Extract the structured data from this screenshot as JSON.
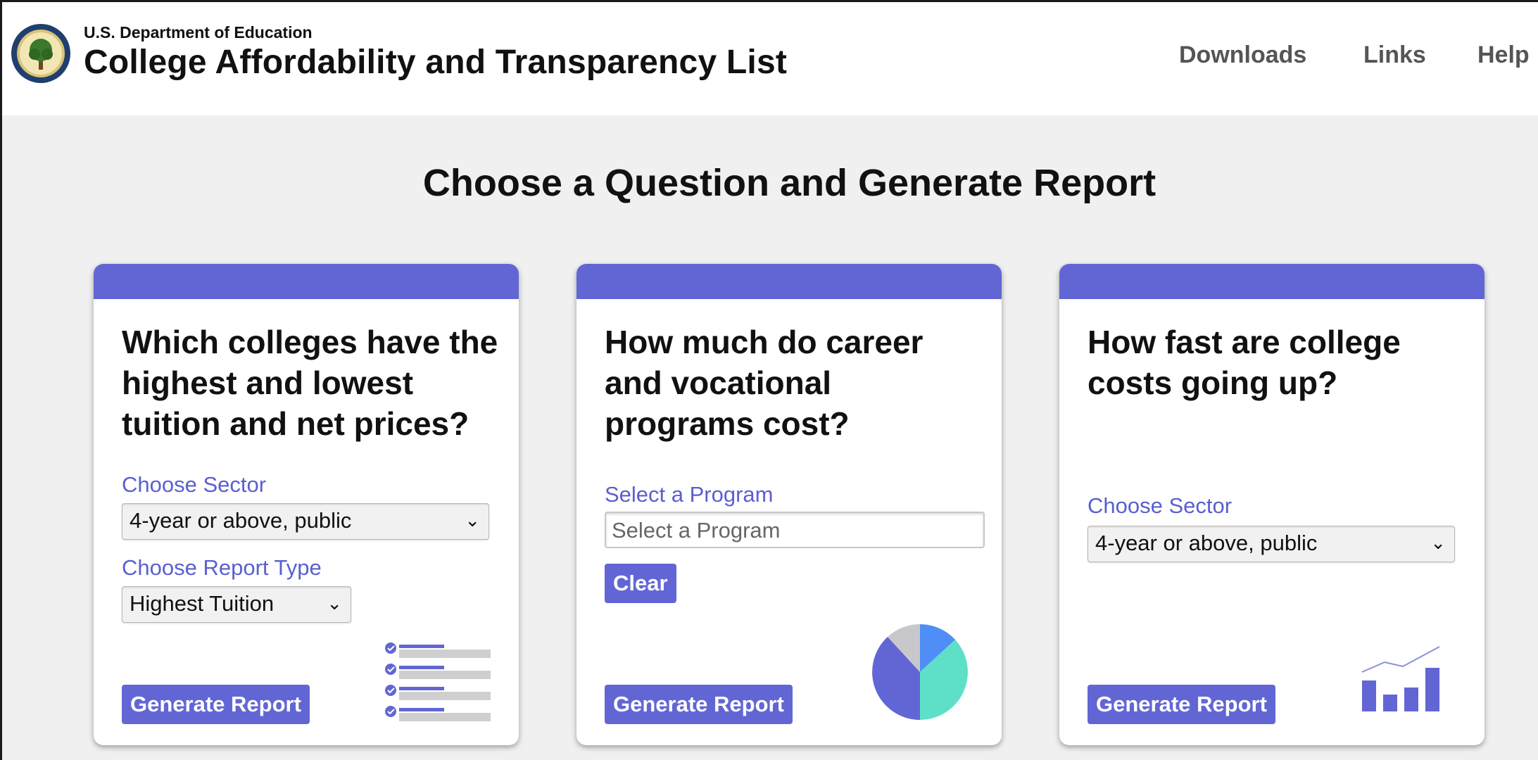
{
  "header": {
    "department": "U.S. Department of Education",
    "title": "College Affordability and Transparency List",
    "nav": [
      "Downloads",
      "Links",
      "Help"
    ]
  },
  "main": {
    "heading": "Choose a Question and Generate Report"
  },
  "cards": [
    {
      "question": "Which colleges have the highest and lowest tuition and net prices?",
      "sector_label": "Choose Sector",
      "sector_value": "4-year or above, public",
      "report_type_label": "Choose Report Type",
      "report_type_value": "Highest Tuition",
      "button": "Generate Report",
      "illustration": "checklist-icon"
    },
    {
      "question": "How much do career and vocational programs cost?",
      "program_label": "Select a Program",
      "program_placeholder": "Select a Program",
      "clear_button": "Clear",
      "button": "Generate Report",
      "illustration": "pie-chart-icon"
    },
    {
      "question": "How fast are college costs going up?",
      "sector_label": "Choose Sector",
      "sector_value": "4-year or above, public",
      "button": "Generate Report",
      "illustration": "bar-line-chart-icon"
    }
  ],
  "colors": {
    "accent": "#6266d4",
    "label": "#5a5fcf",
    "background": "#f0f0f0",
    "pie_slices": [
      "#6266d4",
      "#5ee0c8",
      "#4f8ef7",
      "#c8c8cc"
    ]
  }
}
